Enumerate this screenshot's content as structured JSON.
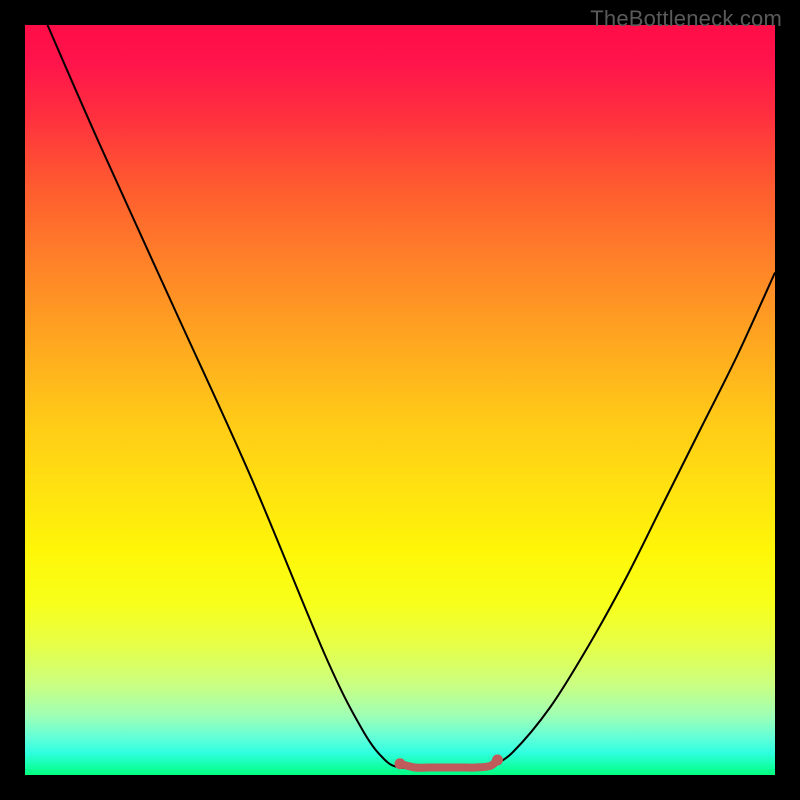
{
  "watermark": "TheBottleneck.com",
  "chart_data": {
    "type": "line",
    "title": "",
    "xlabel": "",
    "ylabel": "",
    "xlim": [
      0,
      100
    ],
    "ylim": [
      0,
      100
    ],
    "grid": false,
    "series": [
      {
        "name": "left-descending-curve",
        "color": "#000000",
        "x": [
          3,
          10,
          20,
          30,
          40,
          45,
          48,
          50,
          52
        ],
        "y": [
          100,
          84,
          62,
          40,
          16,
          6,
          2,
          1,
          1
        ]
      },
      {
        "name": "valley-floor-marker",
        "color": "#bf5b5b",
        "x": [
          50,
          52,
          54,
          56,
          58,
          60,
          62,
          63
        ],
        "y": [
          1.5,
          1,
          1,
          1,
          1,
          1,
          1.2,
          2
        ]
      },
      {
        "name": "right-ascending-curve",
        "color": "#000000",
        "x": [
          62,
          65,
          70,
          75,
          80,
          85,
          90,
          95,
          100
        ],
        "y": [
          1,
          3,
          9,
          17,
          26,
          36,
          46,
          56,
          67
        ]
      }
    ],
    "annotations": []
  }
}
